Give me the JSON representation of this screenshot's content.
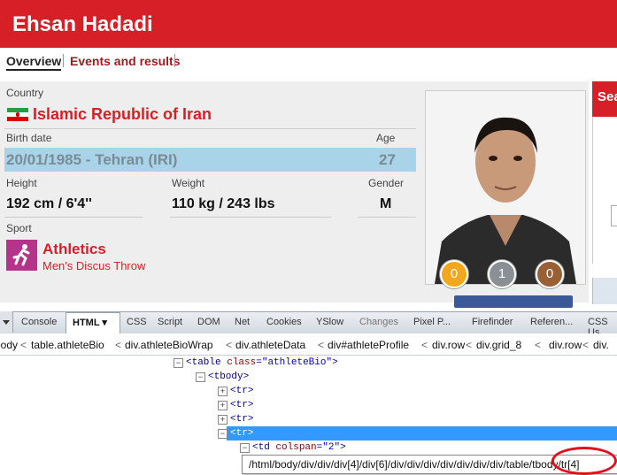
{
  "page": {
    "athlete_name": "Ehsan Hadadi"
  },
  "tabs": [
    "Overview",
    "Events and results"
  ],
  "profile": {
    "country_label": "Country",
    "country": "Islamic Republic of Iran",
    "birth_label": "Birth date",
    "birth_value": "20/01/1985 - Tehran (IRI)",
    "age_label": "Age",
    "age_value": "27",
    "height_label": "Height",
    "height_value": "192 cm / 6'4''",
    "weight_label": "Weight",
    "weight_value": "110 kg / 243 lbs",
    "gender_label": "Gender",
    "gender_value": "M",
    "sport_label": "Sport",
    "sport": "Athletics",
    "event": "Men's Discus Throw"
  },
  "medals": {
    "gold": "0",
    "silver": "1",
    "bronze": "0"
  },
  "side": {
    "search_label": "Sea"
  },
  "devtools": {
    "tabs": [
      "Console",
      "HTML ▾",
      "CSS",
      "Script",
      "DOM",
      "Net",
      "Cookies",
      "YSlow",
      "Changes",
      "Pixel P...",
      "Firefinder",
      "Referen...",
      "CSS Us"
    ],
    "breadcrumbs": [
      "body",
      "table.athleteBio",
      "div.athleteBioWrap",
      "div.athleteData",
      "div#athleteProfile",
      "div.row",
      "div.grid_8",
      "div.row",
      "div."
    ],
    "tree": {
      "table_tag": "table",
      "table_attr": "class",
      "table_val": "\"athleteBio\"",
      "tbody": "tbody",
      "tr": "tr",
      "td_tag": "td",
      "td_attr": "colspan",
      "td_val": "\"2\""
    },
    "xpath": "/html/body/div/div/div[4]/div[6]/div/div/div/div/div/div/div/table/tbody/tr[4]"
  },
  "colors": {
    "brand_red": "#d71f27",
    "highlight": "#a9d3e8",
    "selection": "#3399ff"
  }
}
